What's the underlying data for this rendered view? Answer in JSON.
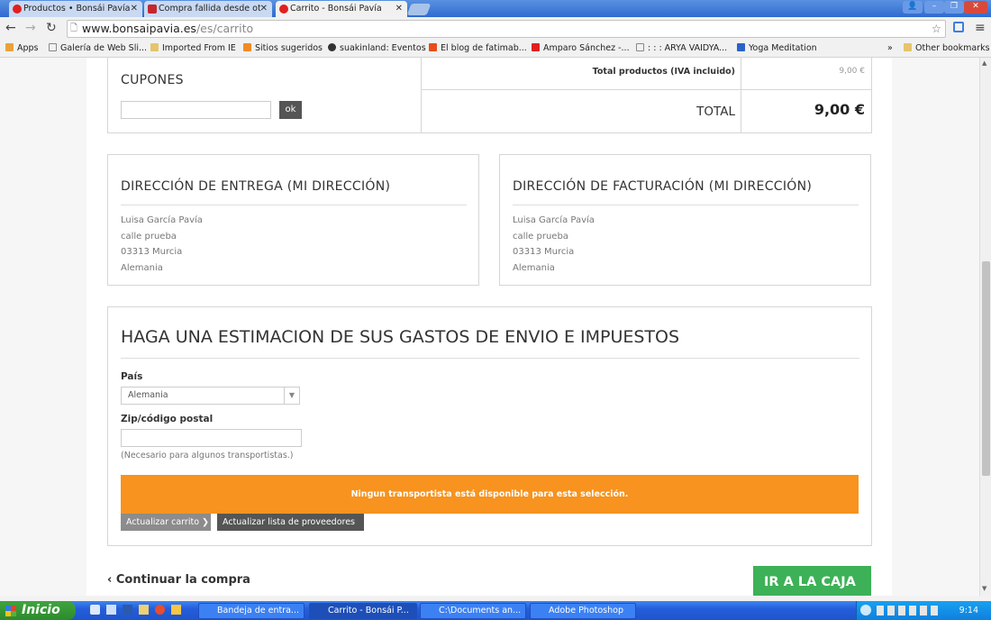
{
  "browser": {
    "tabs": [
      {
        "label": "Productos • Bonsái Pavía",
        "icon_color": "#e02020"
      },
      {
        "label": "Compra fallida desde ot",
        "icon_color": "#c4262e"
      },
      {
        "label": "Carrito - Bonsái Pavía",
        "icon_color": "#e02020"
      }
    ],
    "url_host": "www.bonsaipavia.es",
    "url_path": "/es/carrito",
    "bookmarks": [
      "Apps",
      "Galería de Web Sli...",
      "Imported From IE",
      "Sitios sugeridos",
      "suakinland: Eventos",
      "El blog de fatimab...",
      "Amparo Sánchez -...",
      ": : : ARYA VAIDYA...",
      "Yoga Meditation"
    ],
    "bookmarks_overflow": "»",
    "other_bookmarks": "Other bookmarks"
  },
  "coupons": {
    "title": "CUPONES",
    "ok_label": "ok",
    "input_value": ""
  },
  "totals": {
    "products_label": "Total productos (IVA incluido)",
    "products_value": "9,00 €",
    "total_label": "TOTAL",
    "total_value": "9,00 €"
  },
  "delivery": {
    "title": "DIRECCIÓN DE ENTREGA (MI DIRECCIÓN)",
    "lines": [
      "Luisa García Pavía",
      "calle prueba",
      "03313 Murcia",
      "Alemania"
    ]
  },
  "billing": {
    "title": "DIRECCIÓN DE FACTURACIÓN (MI DIRECCIÓN)",
    "lines": [
      "Luisa García Pavía",
      "calle prueba",
      "03313 Murcia",
      "Alemania"
    ]
  },
  "estimate": {
    "title": "HAGA UNA ESTIMACION DE SUS GASTOS DE ENVIO E IMPUESTOS",
    "country_label": "País",
    "country_value": "Alemania",
    "zip_label": "Zip/código postal",
    "zip_value": "",
    "zip_hint": "(Necesario para algunos transportistas.)",
    "alert": "Ningun transportista está disponible para esta selección.",
    "alert_color": "#f7931e",
    "update_cart": "Actualizar carrito",
    "update_providers": "Actualizar lista de proveedores"
  },
  "footer": {
    "continue": "Continuar la compra",
    "checkout": "IR A LA CAJA",
    "checkout_color": "#3db157"
  },
  "taskbar": {
    "start": "Inicio",
    "tasks": [
      "Bandeja de entra...",
      "Carrito - Bonsái P...",
      "C:\\Documents an...",
      "Adobe Photoshop"
    ],
    "clock": "9:14"
  }
}
